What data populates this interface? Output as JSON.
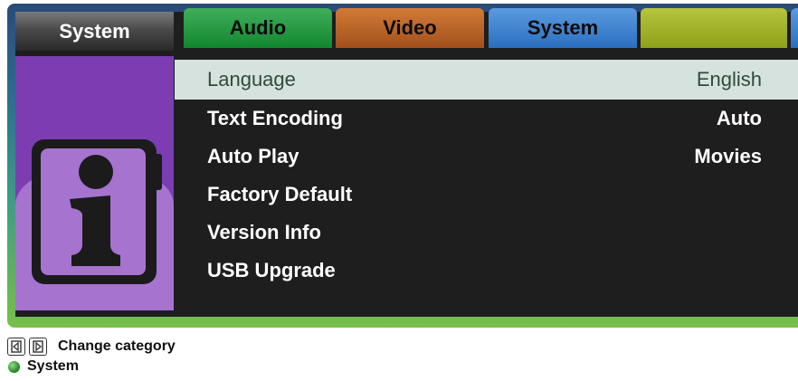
{
  "header": {
    "title": "System"
  },
  "tabs": [
    {
      "label": "Audio"
    },
    {
      "label": "Video"
    },
    {
      "label": "System"
    },
    {
      "label": ""
    }
  ],
  "menu": {
    "items": [
      {
        "label": "Language",
        "value": "English",
        "selected": true
      },
      {
        "label": "Text Encoding",
        "value": "Auto"
      },
      {
        "label": "Auto Play",
        "value": "Movies"
      },
      {
        "label": "Factory Default",
        "value": ""
      },
      {
        "label": "Version Info",
        "value": ""
      },
      {
        "label": "USB Upgrade",
        "value": ""
      }
    ]
  },
  "legend": {
    "change_category": "Change category",
    "current": "System"
  },
  "icons": {
    "category_icon": "info-book-icon",
    "left_key": "left-arrow-key-icon",
    "right_key": "right-arrow-key-icon",
    "status_dot": "green-dot-icon"
  },
  "colors": {
    "audio": "#12872f",
    "video": "#a2501c",
    "system": "#2a6fc0",
    "extra": "#8fa116",
    "side_panel": "#7b3db1",
    "selection": "#d6e2de"
  }
}
